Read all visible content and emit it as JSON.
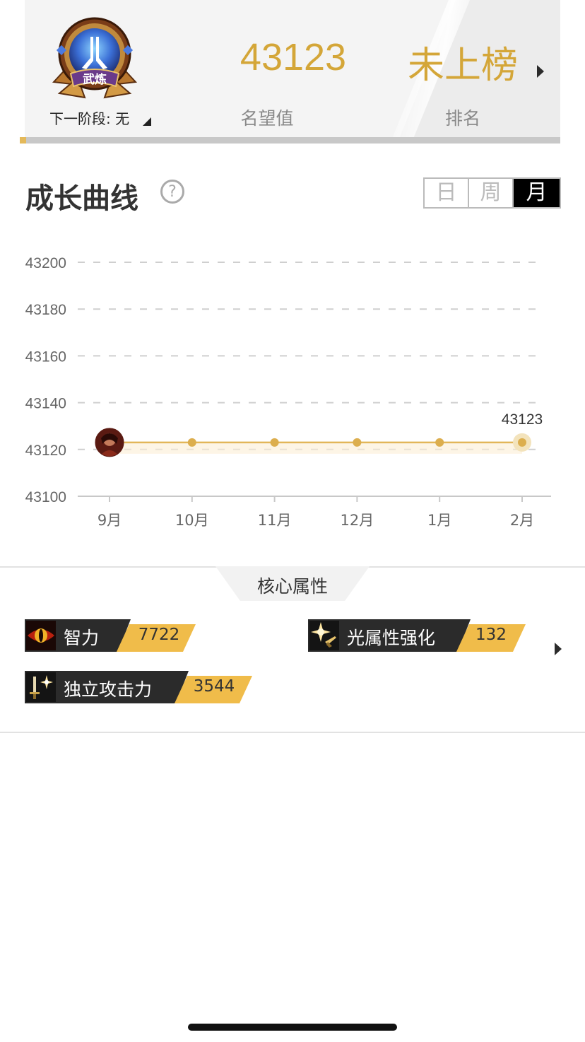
{
  "header": {
    "badge_text": "武炼",
    "next_stage": "下一阶段: 无",
    "renown_value": "43123",
    "renown_label": "名望值",
    "rank_value": "未上榜",
    "rank_label": "排名",
    "accent_color": "#d4a638"
  },
  "growth": {
    "title": "成长曲线",
    "help_symbol": "?",
    "tabs": [
      {
        "label": "日",
        "active": false
      },
      {
        "label": "周",
        "active": false
      },
      {
        "label": "月",
        "active": true
      }
    ]
  },
  "chart_data": {
    "type": "line",
    "categories": [
      "9月",
      "10月",
      "11月",
      "12月",
      "1月",
      "2月"
    ],
    "values": [
      43123,
      43123,
      43123,
      43123,
      43123,
      43123
    ],
    "ylim": [
      43100,
      43200
    ],
    "yticks": [
      "43200",
      "43180",
      "43160",
      "43140",
      "43120",
      "43100"
    ],
    "last_label": "43123",
    "grid": true,
    "line_color": "#e2b659"
  },
  "attributes": {
    "section_label": "核心属性",
    "items": [
      {
        "name": "智力",
        "value": "7722",
        "icon": "eye-icon"
      },
      {
        "name": "光属性强化",
        "value": "132",
        "icon": "light-sword-icon"
      },
      {
        "name": "独立攻击力",
        "value": "3544",
        "icon": "sword-sparkle-icon"
      }
    ]
  }
}
